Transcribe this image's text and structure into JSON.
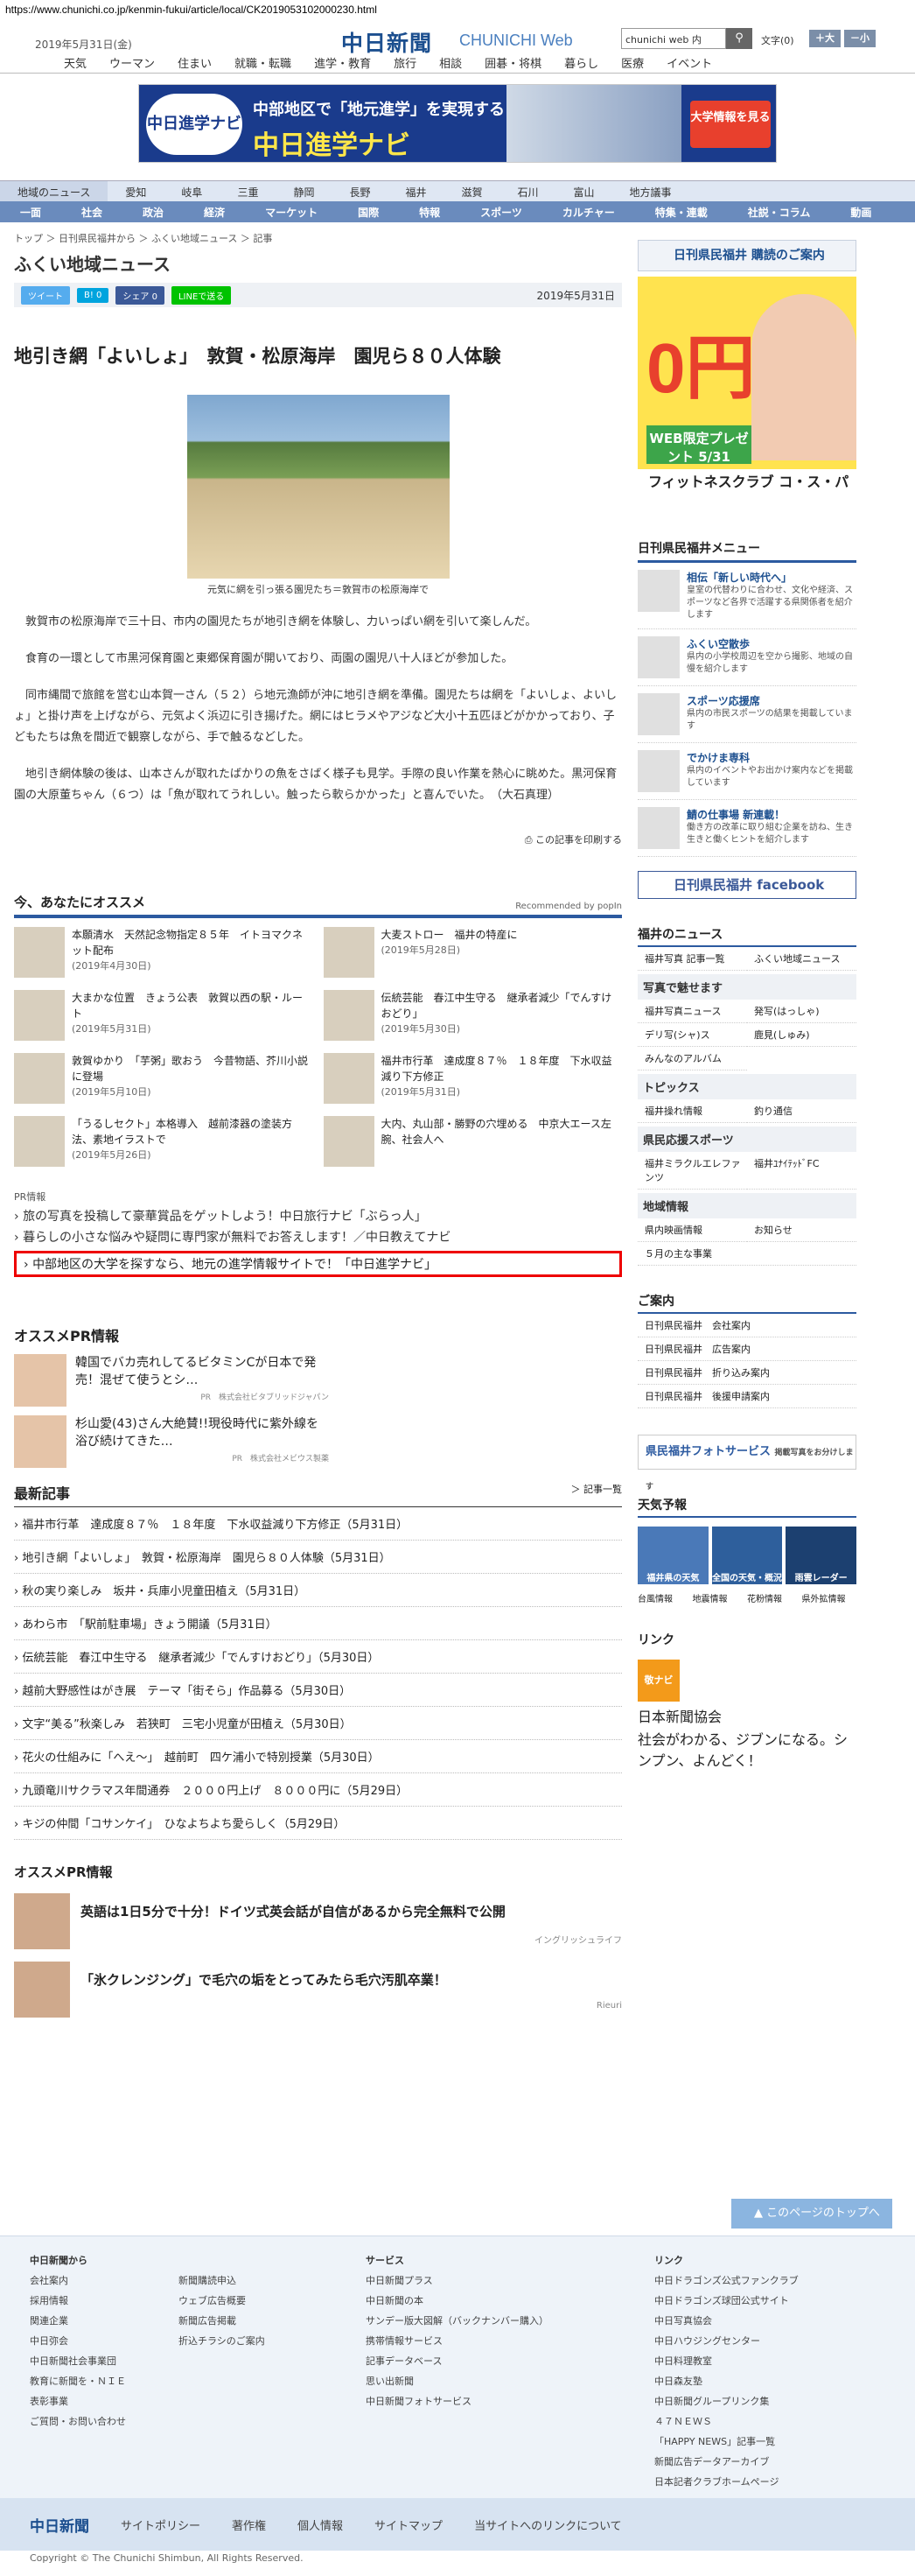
{
  "url": "https://www.chunichi.co.jp/kenmin-fukui/article/local/CK2019053102000230.html",
  "header": {
    "date": "2019年5月31日(金)",
    "logo": "中日新聞",
    "logo_sub": "CHUNICHI Web",
    "search_value": "chunichi web 内",
    "search_icon": "search-icon",
    "font_label": "文字",
    "font_size": "(0)",
    "font_up": "＋大",
    "font_down": "－小"
  },
  "nav1": [
    "天気",
    "ウーマン",
    "住まい",
    "就職・転職",
    "進学・教育",
    "旅行",
    "相談",
    "囲碁・将棋",
    "暮らし",
    "医療",
    "イベント"
  ],
  "banner": {
    "logo": "中日進学ナビ",
    "line1": "中部地区で「地元進学」を実現する",
    "line2": "中日進学ナビ",
    "btn": "大学情報を見る"
  },
  "nav2": [
    "地域のニュース",
    "愛知",
    "岐阜",
    "三重",
    "静岡",
    "長野",
    "福井",
    "滋賀",
    "石川",
    "富山",
    "地方議事"
  ],
  "nav3": [
    "一面",
    "社会",
    "政治",
    "経済",
    "マーケット",
    "国際",
    "特報",
    "スポーツ",
    "カルチャー",
    "特集・連載",
    "社説・コラム",
    "動画"
  ],
  "crumb": "トップ ＞ 日刊県民福井から ＞ ふくい地域ニュース ＞ 記事",
  "section": "ふくい地域ニュース",
  "social": {
    "tweet": "ツイート",
    "hatena": "B! 0",
    "share": "シェア 0",
    "line": "LINEで送る",
    "date": "2019年5月31日"
  },
  "headline": "地引き網「よいしょ」　敦賀・松原海岸　園児ら８０人体験",
  "caption": "元気に網を引っ張る園児たち＝敦賀市の松原海岸で",
  "body": [
    "敦賀市の松原海岸で三十日、市内の園児たちが地引き網を体験し、力いっぱい網を引いて楽しんだ。",
    "食育の一環として市黒河保育園と東郷保育園が開いており、両園の園児八十人ほどが参加した。",
    "同市縄間で旅館を営む山本賀一さん（５２）ら地元漁師が沖に地引き網を準備。園児たちは網を「よいしょ、よいしょ」と掛け声を上げながら、元気よく浜辺に引き揚げた。網にはヒラメやアジなど大小十五匹ほどがかかっており、子どもたちは魚を間近で観察しながら、手で触るなどした。",
    "地引き網体験の後は、山本さんが取れたばかりの魚をさばく様子も見学。手際の良い作業を熱心に眺めた。黒河保育園の大原董ちゃん（６つ）は「魚が取れてうれしい。触ったら軟らかかった」と喜んでいた。　（大石真理）"
  ],
  "print": "この記事を印刷する",
  "rec_title": "今、あなたにオススメ",
  "rec_by": "Recommended by popIn",
  "recs": [
    {
      "t": "本願清水　天然記念物指定８５年　イトヨマクネット配布",
      "d": "(2019年4月30日)"
    },
    {
      "t": "大麦ストロー　福井の特産に",
      "d": "(2019年5月28日)"
    },
    {
      "t": "大まかな位置　きょう公表　敦賀以西の駅・ルート",
      "d": "(2019年5月31日)"
    },
    {
      "t": "伝統芸能　春江中生守る　継承者減少「でんすけおどり」",
      "d": "(2019年5月30日)"
    },
    {
      "t": "敦賀ゆかり　「芋粥」歌おう　今昔物語、芥川小説に登場",
      "d": "(2019年5月10日)"
    },
    {
      "t": "福井市行革　達成度８７％　１８年度　下水収益減り下方修正",
      "d": "(2019年5月31日)"
    },
    {
      "t": "「うるしセクト」本格導入　越前漆器の塗装方法、素地イラストで",
      "d": "(2019年5月26日)"
    },
    {
      "t": "大内、丸山部・勝野の穴埋める　中京大エース左腕、社会人へ",
      "d": ""
    }
  ],
  "pr_label": "PR情報",
  "pr_links": [
    "旅の写真を投稿して豪華賞品をゲットしよう！中日旅行ナビ「ぶらっ人」",
    "暮らしの小さな悩みや疑問に専門家が無料でお答えします！／中日教えてナビ"
  ],
  "pr_highlight": "中部地区の大学を探すなら、地元の進学情報サイトで！「中日進学ナビ」",
  "osusume": "オススメPR情報",
  "ads": [
    {
      "t": "韓国でバカ売れしてるビタミンCが日本で発売！混ぜて使うとシ…",
      "s": "PR　株式会社ビタブリッドジャパン"
    },
    {
      "t": "杉山愛(43)さん大絶賛!!現役時代に紫外線を浴び続けてきた…",
      "s": "PR　株式会社メビウス製薬"
    }
  ],
  "latest_title": "最新記事",
  "latest_more": "＞ 記事一覧",
  "latest": [
    "福井市行革　達成度８７％　１８年度　下水収益減り下方修正（5月31日）",
    "地引き網「よいしょ」　敦賀・松原海岸　園児ら８０人体験（5月31日）",
    "秋の実り楽しみ　坂井・兵庫小児童田植え（5月31日）",
    "あわら市　「駅前駐車場」きょう開議（5月31日）",
    "伝統芸能　春江中生守る　継承者減少「でんすけおどり」（5月30日）",
    "越前大野感性はがき展　テーマ「街そら」作品募る（5月30日）",
    "文字“美る”秋楽しみ　若狭町　三宅小児童が田植え（5月30日）",
    "花火の仕組みに「へえ～」　越前町　四ケ浦小で特別授業（5月30日）",
    "九頭竜川サクラマス年間通券　２０００円上げ　８０００円に（5月29日）",
    "キジの仲間「コサンケイ」　ひなよちよち愛らしく（5月29日）"
  ],
  "pr2_title": "オススメPR情報",
  "pr2": [
    {
      "t": "英語は1日5分で十分！ドイツ式英会話が自信があるから完全無料で公開",
      "s": "イングリッシュライフ"
    },
    {
      "t": "「氷クレンジング」で毛穴の垢をとってみたら毛穴汚肌卒業！",
      "s": "Rieuri"
    }
  ],
  "right": {
    "subscribe": "日刊県民福井 購読のご案内",
    "ad_zero": "0円",
    "ad_web": "WEB限定プレゼント 5/31",
    "ad_brand": "フィットネスクラブ コ・ス・パ",
    "menu_title": "日刊県民福井メニュー",
    "menu": [
      {
        "t": "相伝「新しい時代へ」",
        "d": "皇室の代替わりに合わせ、文化や経済、スポーツなど各界で活躍する県関係者を紹介します"
      },
      {
        "t": "ふくい空散歩",
        "d": "県内の小学校周辺を空から撮影、地域の自慢を紹介します"
      },
      {
        "t": "スポーツ応援席",
        "d": "県内の市民スポーツの結果を掲載しています"
      },
      {
        "t": "でかけま専科",
        "d": "県内のイベントやお出かけ案内などを掲載しています"
      },
      {
        "t": "鯖の仕事場 新連載！",
        "d": "働き方の改革に取り組む企業を訪ね、生き生きと働くヒントを紹介します"
      }
    ],
    "facebook": "日刊県民福井 facebook",
    "fukui_news": "福井のニュース",
    "grid1": [
      "福井写真 記事一覧",
      "ふくい地域ニュース"
    ],
    "photo_sec": "写真で魅せます",
    "grid2": [
      "福井写真ニュース",
      "発写(はっしゃ)",
      "デリ写(シャ)ス",
      "鹿見(しゅみ)",
      "みんなのアルバム"
    ],
    "topics": "トピックス",
    "grid3": [
      "福井操れ情報",
      "釣り通信"
    ],
    "sports": "県民応援スポーツ",
    "grid4": [
      "福井ミラクルエレファンツ",
      "福井ﾕﾅｲﾃｯﾄﾞFC"
    ],
    "area": "地域情報",
    "grid5": [
      "県内映画情報",
      "お知らせ"
    ],
    "area2": "５月の主な事業",
    "guide_title": "ご案内",
    "guide": [
      "日刊県民福井　会社案内",
      "日刊県民福井　広告案内",
      "日刊県民福井　折り込み案内",
      "日刊県民福井　後援申請案内"
    ],
    "photo_service": "県民福井フォトサービス",
    "photo_service_sub": "掲載写真をお分けします",
    "weather_title": "天気予報",
    "weather": [
      "福井県の天気",
      "全国の天気・概況",
      "雨雲レーダー"
    ],
    "weather_links": [
      "台風情報",
      "地震情報",
      "花粉情報",
      "県外拡情報"
    ],
    "link_title": "リンク",
    "link_logo": "敬ナビ",
    "link_name": "日本新聞協会",
    "link_desc": "社会がわかる、ジブンになる。シンプン、よんどく！"
  },
  "topbtn": "このページのトップへ",
  "footer": {
    "c1_head": "中日新聞から",
    "c1": [
      "会社案内",
      "採用情報",
      "関連企業",
      "中日弥会",
      "中日新聞社会事業団",
      "教育に新聞を・ＮＩＥ",
      "表彰事業",
      "ご質問・お問い合わせ"
    ],
    "c2": [
      "新聞購読申込",
      "ウェブ広告概要",
      "新聞広告掲載",
      "折込チラシのご案内"
    ],
    "c3_head": "サービス",
    "c3": [
      "中日新聞プラス",
      "中日新聞の本",
      "サンデー版大図解（バックナンバー購入）",
      "携帯情報サービス",
      "記事データベース",
      "思い出新聞",
      "中日新聞フォトサービス"
    ],
    "c4_head": "リンク",
    "c4": [
      "中日ドラゴンズ公式ファンクラブ",
      "中日ドラゴンズ球団公式サイト",
      "中日写真協会",
      "中日ハウジングセンター",
      "中日料理教室",
      "中日森友塾",
      "中日新聞グループリンク集",
      "４７ＮＥＷＳ",
      "「HAPPY NEWS」記事一覧",
      "新聞広告データアーカイブ",
      "日本記者クラブホームページ"
    ]
  },
  "foot2": {
    "logo": "中日新聞",
    "links": [
      "サイトポリシー",
      "著作権",
      "個人情報",
      "サイトマップ",
      "当サイトへのリンクについて"
    ]
  },
  "copyright": "Copyright © The Chunichi Shimbun, All Rights Reserved."
}
